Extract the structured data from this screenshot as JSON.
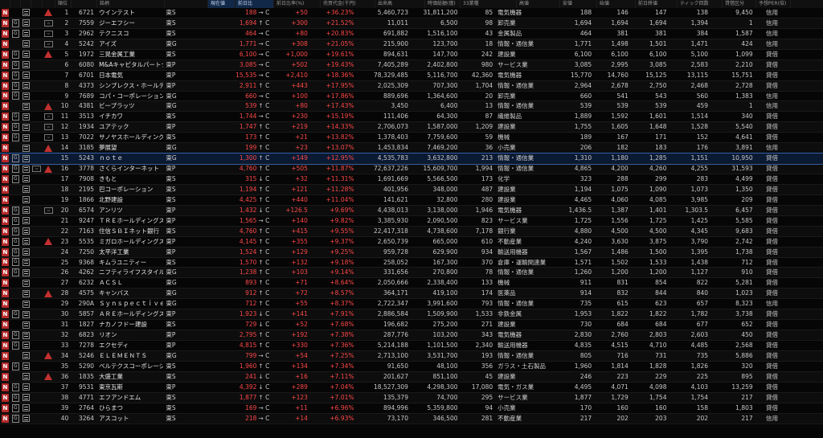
{
  "headers": [
    "",
    "",
    "",
    "",
    "",
    "順位",
    "銘柄",
    "",
    "現在値",
    "前日比",
    "前日比率(%)",
    "売買代金(千円)",
    "出来高",
    "時価総額(億)",
    "33業種",
    "高値",
    "安値",
    "始値",
    "前日終値",
    "ティック回数",
    "貸借区分",
    "予想PER(倍)"
  ],
  "rows": [
    {
      "flags": [
        "N",
        "",
        "",
        "W"
      ],
      "rank": "1",
      "code": "6721",
      "name": "ウインテスト",
      "mkt": "東S",
      "price": "188",
      "arrow": "→ C",
      "chg": "+50",
      "pct": "+36.23%",
      "amt": "5,460,723",
      "vol": "31,811,200",
      "cap": "85",
      "ind": "電気機器",
      "hi": "188",
      "lo": "146",
      "op": "147",
      "pc": "138",
      "tick": "9,450",
      "cls": "信用"
    },
    {
      "flags": [
        "N",
        "G",
        "",
        "R"
      ],
      "rank": "2",
      "code": "7559",
      "name": "ジーエフシー",
      "mkt": "東S",
      "price": "1,694",
      "arrow": "↑ C",
      "chg": "+300",
      "pct": "+21.52%",
      "amt": "11,011",
      "vol": "6,500",
      "cap": "98",
      "ind": "卸売業",
      "hi": "1,694",
      "lo": "1,694",
      "op": "1,694",
      "pc": "1,394",
      "tick": "1",
      "cls": "信用"
    },
    {
      "flags": [
        "N",
        "G",
        "",
        "R"
      ],
      "rank": "3",
      "code": "2962",
      "name": "テクニスコ",
      "mkt": "東S",
      "price": "464",
      "arrow": "→ C",
      "chg": "+80",
      "pct": "+20.83%",
      "amt": "691,882",
      "vol": "1,516,100",
      "cap": "43",
      "ind": "金属製品",
      "hi": "464",
      "lo": "381",
      "op": "381",
      "pc": "384",
      "tick": "1,587",
      "cls": "信用"
    },
    {
      "flags": [
        "N",
        "",
        "",
        "R"
      ],
      "rank": "4",
      "code": "5242",
      "name": "アイズ",
      "mkt": "東G",
      "price": "1,771",
      "arrow": "→ C",
      "chg": "+308",
      "pct": "+21.05%",
      "amt": "215,900",
      "vol": "123,700",
      "cap": "18",
      "ind": "情報・通信業",
      "hi": "1,771",
      "lo": "1,498",
      "lo2": "",
      "op": "1,501",
      "pc": "1,471",
      "tick": "424",
      "cls": "信用"
    },
    {
      "flags": [
        "N",
        "G",
        "",
        "W"
      ],
      "rank": "5",
      "code": "1972",
      "name": "三晃金属工業",
      "mkt": "東S",
      "price": "6,100",
      "arrow": "→ C",
      "chg": "+1,000",
      "pct": "+19.61%",
      "amt": "894,631",
      "vol": "147,700",
      "cap": "242",
      "ind": "建設業",
      "hi": "6,100",
      "lo": "6,100",
      "op": "6,100",
      "pc": "5,100",
      "tick": "1,099",
      "cls": "貸借"
    },
    {
      "flags": [
        "N",
        "G",
        "",
        ""
      ],
      "rank": "6",
      "code": "6080",
      "name": "M&Aキャピタルパートナーズ",
      "mkt": "東P",
      "price": "3,085",
      "arrow": "→ C",
      "chg": "+502",
      "pct": "+19.43%",
      "amt": "7,405,289",
      "vol": "2,402,800",
      "cap": "980",
      "ind": "サービス業",
      "hi": "3,085",
      "lo": "2,995",
      "op": "3,085",
      "pc": "2,583",
      "tick": "2,210",
      "cls": "貸借"
    },
    {
      "flags": [
        "N",
        "G",
        "",
        ""
      ],
      "rank": "7",
      "code": "6701",
      "name": "日本電気",
      "mkt": "東P",
      "price": "15,535",
      "arrow": "→ C",
      "chg": "+2,410",
      "pct": "+18.36%",
      "amt": "78,329,485",
      "vol": "5,116,700",
      "cap": "42,360",
      "ind": "電気機器",
      "hi": "15,770",
      "lo": "14,760",
      "op": "15,125",
      "pc": "13,115",
      "tick": "15,751",
      "cls": "貸借"
    },
    {
      "flags": [
        "N",
        "G",
        "",
        ""
      ],
      "rank": "8",
      "code": "4373",
      "name": "シンプレクス・ホールディングス",
      "mkt": "東P",
      "price": "2,911",
      "arrow": "↑ C",
      "chg": "+443",
      "pct": "+17.95%",
      "amt": "2,025,309",
      "vol": "707,300",
      "cap": "1,704",
      "ind": "情報・通信業",
      "hi": "2,964",
      "lo": "2,678",
      "op": "2,750",
      "pc": "2,468",
      "tick": "2,728",
      "cls": "貸借"
    },
    {
      "flags": [
        "N",
        "G",
        "",
        ""
      ],
      "rank": "9",
      "code": "7689",
      "name": "コパ・コーポレーション",
      "mkt": "東G",
      "price": "660",
      "arrow": "→ C",
      "chg": "+100",
      "pct": "+17.86%",
      "amt": "889,696",
      "vol": "1,364,600",
      "cap": "20",
      "ind": "卸売業",
      "hi": "660",
      "lo": "541",
      "op": "543",
      "pc": "560",
      "tick": "1,383",
      "cls": "信用"
    },
    {
      "flags": [
        "N",
        "",
        "",
        "W"
      ],
      "rank": "10",
      "code": "4381",
      "name": "ビープラッツ",
      "mkt": "東G",
      "price": "539",
      "arrow": "↑ C",
      "chg": "+80",
      "pct": "+17.43%",
      "amt": "3,450",
      "vol": "6,400",
      "cap": "13",
      "ind": "情報・通信業",
      "hi": "539",
      "lo": "539",
      "op": "539",
      "pc": "459",
      "tick": "1",
      "cls": "信用"
    },
    {
      "flags": [
        "N",
        "G",
        "",
        "R"
      ],
      "rank": "11",
      "code": "3513",
      "name": "イチカワ",
      "mkt": "東S",
      "price": "1,744",
      "arrow": "→ C",
      "chg": "+230",
      "pct": "+15.19%",
      "amt": "111,406",
      "vol": "64,300",
      "cap": "87",
      "ind": "繊維製品",
      "hi": "1,889",
      "lo": "1,592",
      "op": "1,601",
      "pc": "1,514",
      "tick": "340",
      "cls": "貸借"
    },
    {
      "flags": [
        "N",
        "G",
        "",
        "R"
      ],
      "rank": "12",
      "code": "1934",
      "name": "ユアテック",
      "mkt": "東P",
      "price": "1,747",
      "arrow": "↑ C",
      "chg": "+219",
      "pct": "+14.33%",
      "amt": "2,706,073",
      "vol": "1,587,000",
      "cap": "1,209",
      "ind": "建設業",
      "hi": "1,755",
      "lo": "1,605",
      "op": "1,648",
      "pc": "1,528",
      "tick": "5,540",
      "cls": "貸借"
    },
    {
      "flags": [
        "N",
        "G",
        "",
        "R"
      ],
      "rank": "13",
      "code": "7022",
      "name": "サノヤスホールディングス",
      "mkt": "東S",
      "price": "173",
      "arrow": "↑ C",
      "chg": "+21",
      "pct": "+13.82%",
      "amt": "1,378,403",
      "vol": "7,759,600",
      "cap": "59",
      "ind": "機械",
      "hi": "189",
      "lo": "167",
      "op": "171",
      "pc": "152",
      "tick": "4,641",
      "cls": "貸借"
    },
    {
      "flags": [
        "N",
        "",
        "",
        "W"
      ],
      "rank": "14",
      "code": "3185",
      "name": "夢展望",
      "mkt": "東G",
      "price": "199",
      "arrow": "↑ C",
      "chg": "+23",
      "pct": "+13.07%",
      "amt": "1,453,834",
      "vol": "7,469,200",
      "cap": "36",
      "ind": "小売業",
      "hi": "206",
      "lo": "182",
      "op": "183",
      "pc": "176",
      "tick": "3,891",
      "cls": "信用"
    },
    {
      "flags": [
        "N",
        "G",
        "",
        ""
      ],
      "rank": "15",
      "code": "5243",
      "name": "ｎｏｔｅ",
      "mkt": "東G",
      "price": "1,300",
      "arrow": "↑ C",
      "chg": "+149",
      "pct": "+12.95%",
      "amt": "4,535,783",
      "vol": "3,632,800",
      "cap": "213",
      "ind": "情報・通信業",
      "hi": "1,310",
      "lo": "1,180",
      "op": "1,285",
      "pc": "1,151",
      "tick": "10,950",
      "cls": "貸借",
      "sel": true
    },
    {
      "flags": [
        "N",
        "G",
        "R",
        "W"
      ],
      "rank": "16",
      "code": "3778",
      "name": "さくらインターネット",
      "mkt": "東P",
      "price": "4,760",
      "arrow": "↑ C",
      "chg": "+505",
      "pct": "+11.87%",
      "amt": "72,637,226",
      "vol": "15,609,700",
      "cap": "1,994",
      "ind": "情報・通信業",
      "hi": "4,865",
      "lo": "4,200",
      "op": "4,260",
      "pc": "4,255",
      "tick": "31,593",
      "cls": "貸借"
    },
    {
      "flags": [
        "N",
        "G",
        "",
        ""
      ],
      "rank": "17",
      "code": "7908",
      "name": "きもと",
      "mkt": "東S",
      "price": "315",
      "arrow": "↓ C",
      "chg": "+32",
      "pct": "+11.31%",
      "amt": "1,691,669",
      "vol": "5,566,500",
      "cap": "173",
      "ind": "化学",
      "hi": "323",
      "lo": "288",
      "op": "299",
      "pc": "283",
      "tick": "4,499",
      "cls": "貸借"
    },
    {
      "flags": [
        "N",
        "",
        "",
        ""
      ],
      "rank": "18",
      "code": "2195",
      "name": "巴コーポレーション",
      "mkt": "東S",
      "price": "1,194",
      "arrow": "↑ C",
      "chg": "+121",
      "pct": "+11.28%",
      "amt": "401,956",
      "vol": "348,000",
      "cap": "487",
      "ind": "建設業",
      "hi": "1,194",
      "lo": "1,075",
      "op": "1,090",
      "pc": "1,073",
      "tick": "1,350",
      "cls": "貸借"
    },
    {
      "flags": [
        "N",
        "",
        "",
        ""
      ],
      "rank": "19",
      "code": "1866",
      "name": "北野建設",
      "mkt": "東S",
      "price": "4,425",
      "arrow": "↑ C",
      "chg": "+440",
      "pct": "+11.04%",
      "amt": "141,621",
      "vol": "32,800",
      "cap": "280",
      "ind": "建設業",
      "hi": "4,465",
      "lo": "4,060",
      "op": "4,085",
      "pc": "3,985",
      "tick": "209",
      "cls": "貸借"
    },
    {
      "flags": [
        "N",
        "G",
        "",
        "R"
      ],
      "rank": "20",
      "code": "6574",
      "name": "アンリツ",
      "mkt": "東P",
      "price": "1,432",
      "arrow": "↓ C",
      "chg": "+126.5",
      "pct": "+9.69%",
      "amt": "4,438,013",
      "vol": "3,138,000",
      "cap": "1,946",
      "ind": "電気機器",
      "hi": "1,436.5",
      "lo": "1,387",
      "op": "1,401",
      "pc": "1,303.5",
      "tick": "6,457",
      "cls": "貸借"
    },
    {
      "flags": [
        "N",
        "G",
        "",
        ""
      ],
      "rank": "21",
      "code": "9247",
      "name": "ＴＲＥホールディングス",
      "mkt": "東P",
      "price": "1,565",
      "arrow": "→ C",
      "chg": "+140",
      "pct": "+9.82%",
      "amt": "3,385,930",
      "vol": "2,090,500",
      "cap": "823",
      "ind": "サービス業",
      "hi": "1,725",
      "lo": "1,556",
      "op": "1,725",
      "pc": "1,425",
      "tick": "5,585",
      "cls": "貸借"
    },
    {
      "flags": [
        "N",
        "G",
        "",
        ""
      ],
      "rank": "22",
      "code": "7163",
      "name": "住信ＳＢＩネット銀行",
      "mkt": "東S",
      "price": "4,760",
      "arrow": "↑ C",
      "chg": "+415",
      "pct": "+9.55%",
      "amt": "22,417,318",
      "vol": "4,738,600",
      "cap": "7,178",
      "ind": "銀行業",
      "hi": "4,880",
      "lo": "4,500",
      "op": "4,500",
      "pc": "4,345",
      "tick": "9,683",
      "cls": "貸借"
    },
    {
      "flags": [
        "N",
        "G",
        "",
        "W"
      ],
      "rank": "23",
      "code": "5535",
      "name": "ミガロホールディングス",
      "mkt": "東P",
      "price": "4,145",
      "arrow": "↑ C",
      "chg": "+355",
      "pct": "+9.37%",
      "amt": "2,650,739",
      "vol": "665,000",
      "cap": "610",
      "ind": "不動産業",
      "hi": "4,240",
      "lo": "3,630",
      "op": "3,875",
      "pc": "3,790",
      "tick": "2,742",
      "cls": "貸借"
    },
    {
      "flags": [
        "N",
        "G",
        "",
        ""
      ],
      "rank": "24",
      "code": "7250",
      "name": "太平洋工業",
      "mkt": "東P",
      "price": "1,524",
      "arrow": "↑ C",
      "chg": "+129",
      "pct": "+9.25%",
      "amt": "959,728",
      "vol": "629,900",
      "cap": "934",
      "ind": "輸送用機器",
      "hi": "1,567",
      "lo": "1,486",
      "op": "1,500",
      "pc": "1,395",
      "tick": "1,738",
      "cls": "貸借"
    },
    {
      "flags": [
        "N",
        "G",
        "",
        ""
      ],
      "rank": "25",
      "code": "9368",
      "name": "キムラユニティー",
      "mkt": "東S",
      "price": "1,570",
      "arrow": "↑ C",
      "chg": "+132",
      "pct": "+9.18%",
      "amt": "258,052",
      "vol": "167,300",
      "cap": "370",
      "ind": "倉庫・運輸関連業",
      "hi": "1,571",
      "lo": "1,502",
      "op": "1,533",
      "pc": "1,438",
      "tick": "712",
      "cls": "貸借"
    },
    {
      "flags": [
        "N",
        "G",
        "",
        ""
      ],
      "rank": "26",
      "code": "4262",
      "name": "ニフティライフスタイル",
      "mkt": "東G",
      "price": "1,238",
      "arrow": "↑ C",
      "chg": "+103",
      "pct": "+9.14%",
      "amt": "331,656",
      "vol": "270,800",
      "cap": "78",
      "ind": "情報・通信業",
      "hi": "1,260",
      "lo": "1,200",
      "op": "1,200",
      "pc": "1,127",
      "tick": "910",
      "cls": "貸借"
    },
    {
      "flags": [
        "N",
        "",
        "",
        ""
      ],
      "rank": "27",
      "code": "6232",
      "name": "ＡＣＳＬ",
      "mkt": "東G",
      "price": "893",
      "arrow": "↑ C",
      "chg": "+71",
      "pct": "+8.64%",
      "amt": "2,050,666",
      "vol": "2,338,400",
      "cap": "133",
      "ind": "機械",
      "hi": "911",
      "lo": "831",
      "op": "854",
      "pc": "822",
      "tick": "5,281",
      "cls": "貸借"
    },
    {
      "flags": [
        "N",
        "",
        "",
        "W"
      ],
      "rank": "28",
      "code": "4575",
      "name": "キャンバス",
      "mkt": "東G",
      "price": "912",
      "arrow": "↑ C",
      "chg": "+72",
      "pct": "+8.57%",
      "amt": "364,171",
      "vol": "419,100",
      "cap": "174",
      "ind": "医薬品",
      "hi": "914",
      "lo": "832",
      "op": "844",
      "pc": "840",
      "tick": "1,023",
      "cls": "貸借"
    },
    {
      "flags": [
        "N",
        "",
        "",
        ""
      ],
      "rank": "29",
      "code": "290A",
      "name": "Ｓｙｎｓｐｅｃｔｉｖｅ",
      "mkt": "東G",
      "price": "712",
      "arrow": "↑ C",
      "chg": "+55",
      "pct": "+8.37%",
      "amt": "2,722,347",
      "vol": "3,991,600",
      "cap": "793",
      "ind": "情報・通信業",
      "hi": "735",
      "lo": "615",
      "op": "623",
      "pc": "657",
      "tick": "8,323",
      "cls": "信用"
    },
    {
      "flags": [
        "N",
        "G",
        "",
        ""
      ],
      "rank": "30",
      "code": "5857",
      "name": "ＡＲＥホールディングス",
      "mkt": "東P",
      "price": "1,923",
      "arrow": "↓ C",
      "chg": "+141",
      "pct": "+7.91%",
      "amt": "2,886,584",
      "vol": "1,509,900",
      "cap": "1,533",
      "ind": "非鉄金属",
      "hi": "1,953",
      "lo": "1,822",
      "op": "1,822",
      "pc": "1,782",
      "tick": "3,738",
      "cls": "貸借"
    },
    {
      "flags": [
        "N",
        "",
        "",
        ""
      ],
      "rank": "31",
      "code": "1827",
      "name": "ナカノフドー建設",
      "mkt": "東S",
      "price": "729",
      "arrow": "↓ C",
      "chg": "+52",
      "pct": "+7.68%",
      "amt": "196,682",
      "vol": "275,200",
      "cap": "271",
      "ind": "建設業",
      "hi": "730",
      "lo": "684",
      "op": "684",
      "pc": "677",
      "tick": "652",
      "cls": "貸借"
    },
    {
      "flags": [
        "N",
        "G",
        "",
        ""
      ],
      "rank": "32",
      "code": "6823",
      "name": "リオン",
      "mkt": "東P",
      "price": "2,795",
      "arrow": "↑ C",
      "chg": "+192",
      "pct": "+7.38%",
      "amt": "287,776",
      "vol": "103,200",
      "cap": "343",
      "ind": "電気機器",
      "hi": "2,830",
      "lo": "2,760",
      "op": "2,803",
      "pc": "2,603",
      "tick": "450",
      "cls": "貸借"
    },
    {
      "flags": [
        "N",
        "G",
        "",
        ""
      ],
      "rank": "33",
      "code": "7278",
      "name": "エクセディ",
      "mkt": "東P",
      "price": "4,815",
      "arrow": "↑ C",
      "chg": "+330",
      "pct": "+7.36%",
      "amt": "5,214,188",
      "vol": "1,101,500",
      "cap": "2,340",
      "ind": "輸送用機器",
      "hi": "4,835",
      "lo": "4,515",
      "op": "4,710",
      "pc": "4,485",
      "tick": "2,568",
      "cls": "貸借"
    },
    {
      "flags": [
        "N",
        "",
        "",
        "W"
      ],
      "rank": "34",
      "code": "5246",
      "name": "ＥＬＥＭＥＮＴＳ",
      "mkt": "東G",
      "price": "799",
      "arrow": "→ C",
      "chg": "+54",
      "pct": "+7.25%",
      "amt": "2,713,100",
      "vol": "3,531,700",
      "cap": "193",
      "ind": "情報・通信業",
      "hi": "805",
      "lo": "716",
      "op": "731",
      "pc": "735",
      "tick": "5,886",
      "cls": "貸借"
    },
    {
      "flags": [
        "N",
        "G",
        "",
        ""
      ],
      "rank": "35",
      "code": "5290",
      "name": "ベルテクスコーポレーション",
      "mkt": "東S",
      "price": "1,960",
      "arrow": "↑ C",
      "chg": "+134",
      "pct": "+7.34%",
      "amt": "91,650",
      "vol": "48,100",
      "cap": "356",
      "ind": "ガラス・土石製品",
      "hi": "1,960",
      "lo": "1,814",
      "op": "1,828",
      "pc": "1,826",
      "tick": "320",
      "cls": "貸借"
    },
    {
      "flags": [
        "N",
        "",
        "",
        "W"
      ],
      "rank": "36",
      "code": "1835",
      "name": "大盛工業",
      "mkt": "東S",
      "price": "241",
      "arrow": "↓ C",
      "chg": "+16",
      "pct": "+7.11%",
      "amt": "201,627",
      "vol": "851,100",
      "cap": "45",
      "ind": "建設業",
      "hi": "246",
      "lo": "223",
      "op": "229",
      "pc": "225",
      "tick": "895",
      "cls": "貸借"
    },
    {
      "flags": [
        "N",
        "G",
        "",
        ""
      ],
      "rank": "37",
      "code": "9531",
      "name": "東京瓦斯",
      "mkt": "東P",
      "price": "4,392",
      "arrow": "↓ C",
      "chg": "+289",
      "pct": "+7.04%",
      "amt": "18,527,309",
      "vol": "4,298,300",
      "cap": "17,080",
      "ind": "電気・ガス業",
      "hi": "4,495",
      "lo": "4,071",
      "op": "4,098",
      "pc": "4,103",
      "tick": "13,259",
      "cls": "貸借"
    },
    {
      "flags": [
        "N",
        "G",
        "",
        ""
      ],
      "rank": "38",
      "code": "4771",
      "name": "エフアンドエム",
      "mkt": "東S",
      "price": "1,877",
      "arrow": "↑ C",
      "chg": "+123",
      "pct": "+7.01%",
      "amt": "135,379",
      "vol": "74,700",
      "cap": "295",
      "ind": "サービス業",
      "hi": "1,877",
      "lo": "1,729",
      "op": "1,754",
      "pc": "1,754",
      "tick": "217",
      "cls": "貸借"
    },
    {
      "flags": [
        "N",
        "G",
        "",
        ""
      ],
      "rank": "39",
      "code": "2764",
      "name": "ひらまつ",
      "mkt": "東S",
      "price": "169",
      "arrow": "→ C",
      "chg": "+11",
      "pct": "+6.96%",
      "amt": "894,996",
      "vol": "5,359,800",
      "cap": "94",
      "ind": "小売業",
      "hi": "170",
      "lo": "160",
      "op": "160",
      "pc": "158",
      "tick": "1,803",
      "cls": "貸借"
    },
    {
      "flags": [
        "N",
        "G",
        "",
        ""
      ],
      "rank": "40",
      "code": "3264",
      "name": "アスコット",
      "mkt": "東S",
      "price": "218",
      "arrow": "→ C",
      "chg": "+14",
      "pct": "+6.93%",
      "amt": "73,170",
      "vol": "346,500",
      "cap": "281",
      "ind": "不動産業",
      "hi": "217",
      "lo": "202",
      "op": "203",
      "pc": "202",
      "tick": "217",
      "cls": "信用"
    }
  ]
}
